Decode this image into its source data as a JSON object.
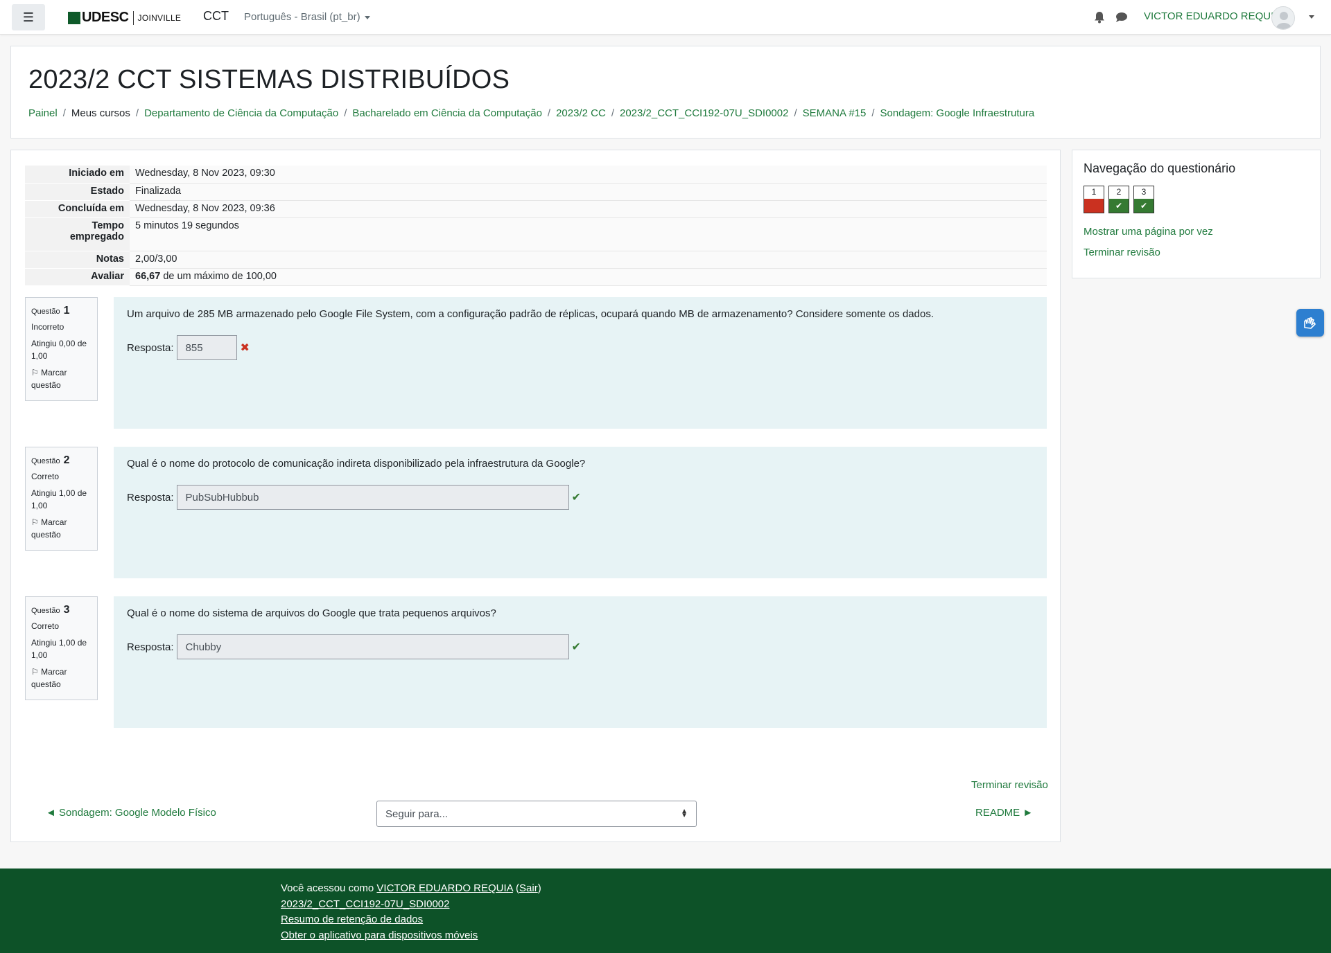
{
  "navbar": {
    "brand_name": "UDESC",
    "brand_sub": "JOINVILLE",
    "site": "CCT",
    "language": "Português - Brasil (pt_br)",
    "user_name": "VICTOR EDUARDO REQUIA",
    "menu_icon": "hamburger-icon",
    "bell_icon": "bell-icon",
    "chat_icon": "chat-icon"
  },
  "header": {
    "title": "2023/2 CCT SISTEMAS DISTRIBUÍDOS",
    "breadcrumb": [
      "Painel",
      "Meus cursos",
      "Departamento de Ciência da Computação",
      "Bacharelado em Ciência da Computação",
      "2023/2 CC",
      "2023/2_CCT_CCI192-07U_SDI0002",
      "SEMANA #15",
      "Sondagem: Google Infraestrutura"
    ]
  },
  "summary": {
    "started_label": "Iniciado em",
    "started_value": "Wednesday, 8 Nov 2023, 09:30",
    "state_label": "Estado",
    "state_value": "Finalizada",
    "completed_label": "Concluída em",
    "completed_value": "Wednesday, 8 Nov 2023, 09:36",
    "time_label_1": "Tempo",
    "time_label_2": "empregado",
    "time_value": "5 minutos 19 segundos",
    "marks_label": "Notas",
    "marks_value": "2,00/3,00",
    "grade_label": "Avaliar",
    "grade_value_bold": "66,67",
    "grade_value_rest": " de um máximo de 100,00"
  },
  "questions": [
    {
      "label": "Questão",
      "number": "1",
      "state": "Incorreto",
      "grade_1": "Atingiu 0,00 de",
      "grade_2": "1,00",
      "flag_1": "Marcar",
      "flag_2": "questão",
      "text": "Um arquivo de 285 MB armazenado pelo Google File System, com a configuração padrão de réplicas, ocupará quando MB de armazenamento? Considere somente os dados.",
      "answer_label": "Resposta:",
      "answer": "855",
      "result": "incorrect"
    },
    {
      "label": "Questão",
      "number": "2",
      "state": "Correto",
      "grade_1": "Atingiu 1,00 de",
      "grade_2": "1,00",
      "flag_1": "Marcar",
      "flag_2": "questão",
      "text": "Qual é o nome do protocolo de comunicação indireta disponibilizado pela infraestrutura da Google?",
      "answer_label": "Resposta:",
      "answer": "PubSubHubbub",
      "result": "correct"
    },
    {
      "label": "Questão",
      "number": "3",
      "state": "Correto",
      "grade_1": "Atingiu 1,00 de",
      "grade_2": "1,00",
      "flag_1": "Marcar",
      "flag_2": "questão",
      "text": "Qual é o nome do sistema de arquivos do Google que trata pequenos arquivos?",
      "answer_label": "Resposta:",
      "answer": "Chubby",
      "result": "correct"
    }
  ],
  "footer_nav": {
    "finish_review": "Terminar revisão",
    "prev_link": "◄ Sondagem: Google Modelo Físico",
    "jump_placeholder": "Seguir para...",
    "next_link": "README ►"
  },
  "quiz_nav": {
    "title": "Navegação do questionário",
    "buttons": [
      {
        "number": "1",
        "state": "incorrect"
      },
      {
        "number": "2",
        "state": "correct"
      },
      {
        "number": "3",
        "state": "correct"
      }
    ],
    "show_one_page": "Mostrar uma página por vez",
    "finish_review": "Terminar revisão"
  },
  "footer": {
    "logged_in_as": "Você acessou como ",
    "user_link": "VICTOR EDUARDO REQUIA",
    "logout_open": " (",
    "logout": "Sair",
    "logout_close": ")",
    "course_link": "2023/2_CCT_CCI192-07U_SDI0002",
    "retention": "Resumo de retenção de dados",
    "mobile_app": "Obter o aplicativo para dispositivos móveis"
  },
  "colors": {
    "accent": "#1f7a3d",
    "footer_bg": "#0d5228",
    "incorrect": "#ca3120",
    "correct": "#357a32",
    "question_bg": "#e7f3f5"
  }
}
